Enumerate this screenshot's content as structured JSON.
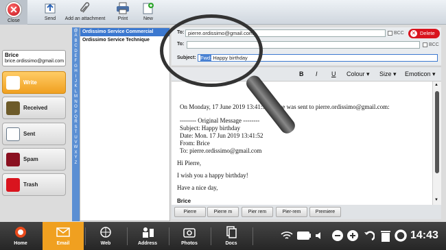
{
  "toolbar": {
    "close_label": "Close",
    "send_label": "Send",
    "attachment_label": "Add an attachment",
    "print_label": "Print",
    "new_label": "New"
  },
  "account": {
    "name": "Brice",
    "email": "brice.ordissimo@gmail.com"
  },
  "folders": [
    {
      "label": "Write",
      "icon": "write-icon"
    },
    {
      "label": "Received",
      "icon": "received-icon"
    },
    {
      "label": "Sent",
      "icon": "sent-icon"
    },
    {
      "label": "Spam",
      "icon": "spam-icon"
    },
    {
      "label": "Trash",
      "icon": "trash-icon"
    }
  ],
  "alphabet": [
    "@",
    "A",
    "B",
    "C",
    "D",
    "E",
    "F",
    "G",
    "H",
    "I",
    "J",
    "K",
    "L",
    "M",
    "N",
    "O",
    "P",
    "Q",
    "R",
    "S",
    "T",
    "U",
    "V",
    "W",
    "X",
    "Y",
    "Z"
  ],
  "contacts": [
    "Ordissimo Service Commercial",
    "Ordissimo Service Technique"
  ],
  "compose": {
    "to_label": "To:",
    "to_value": "pierre.ordissimo@gmail.com",
    "to_label_2": "To:",
    "to_value_2": "",
    "bcc_label": "BCC",
    "bcc_label_2": "BCC",
    "delete_label": "Delete",
    "subject_label": "Subject:",
    "subject_prefix": "Fwd:",
    "subject_value": "Happy birthday"
  },
  "format": {
    "bold": "B",
    "italic": "I",
    "underline": "U",
    "colour": "Colour",
    "size": "Size",
    "emoticon": "Emoticon"
  },
  "message": {
    "intro": "On Monday, 17 June 2019 13:41:52, Brice was sent to pierre.ordissimo@gmail.com:",
    "orig_header": "-------- Original Message --------",
    "orig_subject": "Subject: Happy birthday",
    "orig_date": "Date: Mon. 17 Jun 2019 13:41:52",
    "orig_from": "From: Brice",
    "orig_to": "To: pierre.ordissimo@gmail.com",
    "greeting": "Hi Pierre,",
    "line1": "I wish you a happy birthday!",
    "line2": "Have a nice day,",
    "signature": "Brice"
  },
  "quick_replies": [
    "Pierre",
    "Pierre m",
    "Pier rem",
    "Pier-rem",
    "Premiere"
  ],
  "nav": [
    {
      "label": "Home",
      "icon": "home-icon"
    },
    {
      "label": "Email",
      "icon": "email-icon"
    },
    {
      "label": "Web",
      "icon": "web-icon"
    },
    {
      "label": "Address",
      "icon": "address-icon"
    },
    {
      "label": "Photos",
      "icon": "camera-icon"
    },
    {
      "label": "Docs",
      "icon": "docs-icon"
    }
  ],
  "status": {
    "time": "14:43"
  },
  "colors": {
    "accent": "#f0a020",
    "link_blue": "#3b78d0",
    "delete_red": "#d9141e"
  }
}
